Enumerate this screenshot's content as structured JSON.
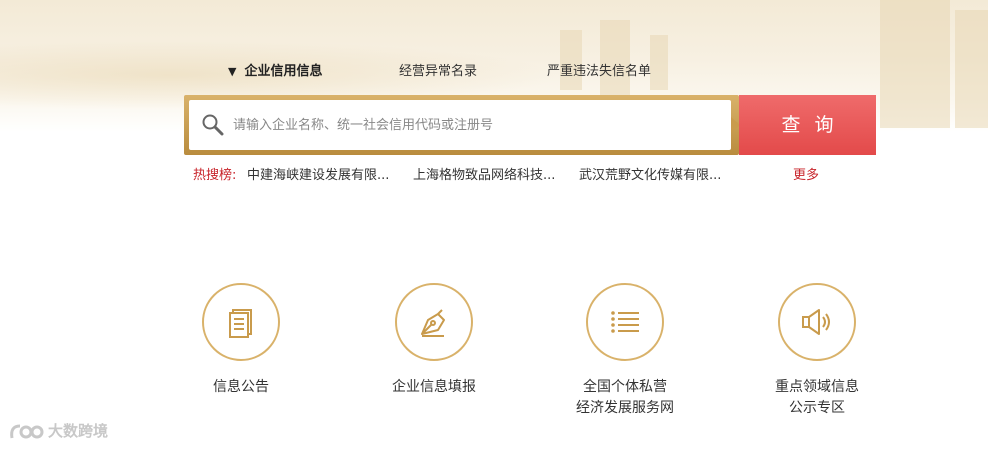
{
  "tabs": [
    {
      "label": "企业信用信息",
      "active": true
    },
    {
      "label": "经营异常名录",
      "active": false
    },
    {
      "label": "严重违法失信名单",
      "active": false
    }
  ],
  "search": {
    "placeholder": "请输入企业名称、统一社会信用代码或注册号",
    "button_label": "查询"
  },
  "hot_search": {
    "label": "热搜榜:",
    "items": [
      "中建海峡建设发展有限...",
      "上海格物致品网络科技...",
      "武汉荒野文化传媒有限..."
    ],
    "more_label": "更多"
  },
  "services": [
    {
      "icon": "document-icon",
      "lines": [
        "信息公告"
      ]
    },
    {
      "icon": "pen-nib-icon",
      "lines": [
        "企业信息填报"
      ]
    },
    {
      "icon": "list-icon",
      "lines": [
        "全国个体私营",
        "经济发展服务网"
      ]
    },
    {
      "icon": "speaker-icon",
      "lines": [
        "重点领域信息",
        "公示专区"
      ]
    }
  ],
  "watermark": {
    "text": "大数跨境"
  },
  "colors": {
    "gold": "#d9b26a",
    "red_button": "#e34a4a",
    "hot_red": "#c8242b"
  }
}
